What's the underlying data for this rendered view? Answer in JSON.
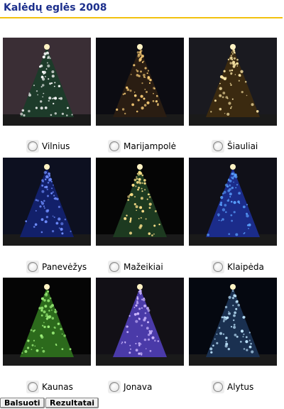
{
  "page": {
    "title": "Kalėdų eglės 2008"
  },
  "colors": {
    "title": "#1c2f8c",
    "rule": "#f2c10f"
  },
  "trees": [
    {
      "city": "Vilnius",
      "icon": "christmas-tree-photo",
      "lights": "#ffffff",
      "tree": "#1d3b2a",
      "sky": "#3a2e35"
    },
    {
      "city": "Marijampolė",
      "icon": "christmas-tree-photo",
      "lights": "#ffd27a",
      "tree": "#2a1d12",
      "sky": "#0c0c12"
    },
    {
      "city": "Šiauliai",
      "icon": "christmas-tree-photo",
      "lights": "#ffe9a8",
      "tree": "#3b2a10",
      "sky": "#1a1a20"
    },
    {
      "city": "Panevėžys",
      "icon": "christmas-tree-photo",
      "lights": "#6f8dff",
      "tree": "#12206a",
      "sky": "#0d1020"
    },
    {
      "city": "Mažeikiai",
      "icon": "christmas-tree-photo",
      "lights": "#ffe28a",
      "tree": "#1d3a20",
      "sky": "#050505"
    },
    {
      "city": "Klaipėda",
      "icon": "christmas-tree-photo",
      "lights": "#5aa0ff",
      "tree": "#1b2c8a",
      "sky": "#101018"
    },
    {
      "city": "Kaunas",
      "icon": "christmas-tree-photo",
      "lights": "#9df07a",
      "tree": "#2c6a1c",
      "sky": "#050505"
    },
    {
      "city": "Jonava",
      "icon": "christmas-tree-photo",
      "lights": "#cdb8ff",
      "tree": "#4a3aa8",
      "sky": "#121016"
    },
    {
      "city": "Alytus",
      "icon": "christmas-tree-photo",
      "lights": "#bfe6ff",
      "tree": "#1a3050",
      "sky": "#050810"
    }
  ],
  "buttons": {
    "vote": "Balsuoti",
    "results": "Rezultatai"
  }
}
